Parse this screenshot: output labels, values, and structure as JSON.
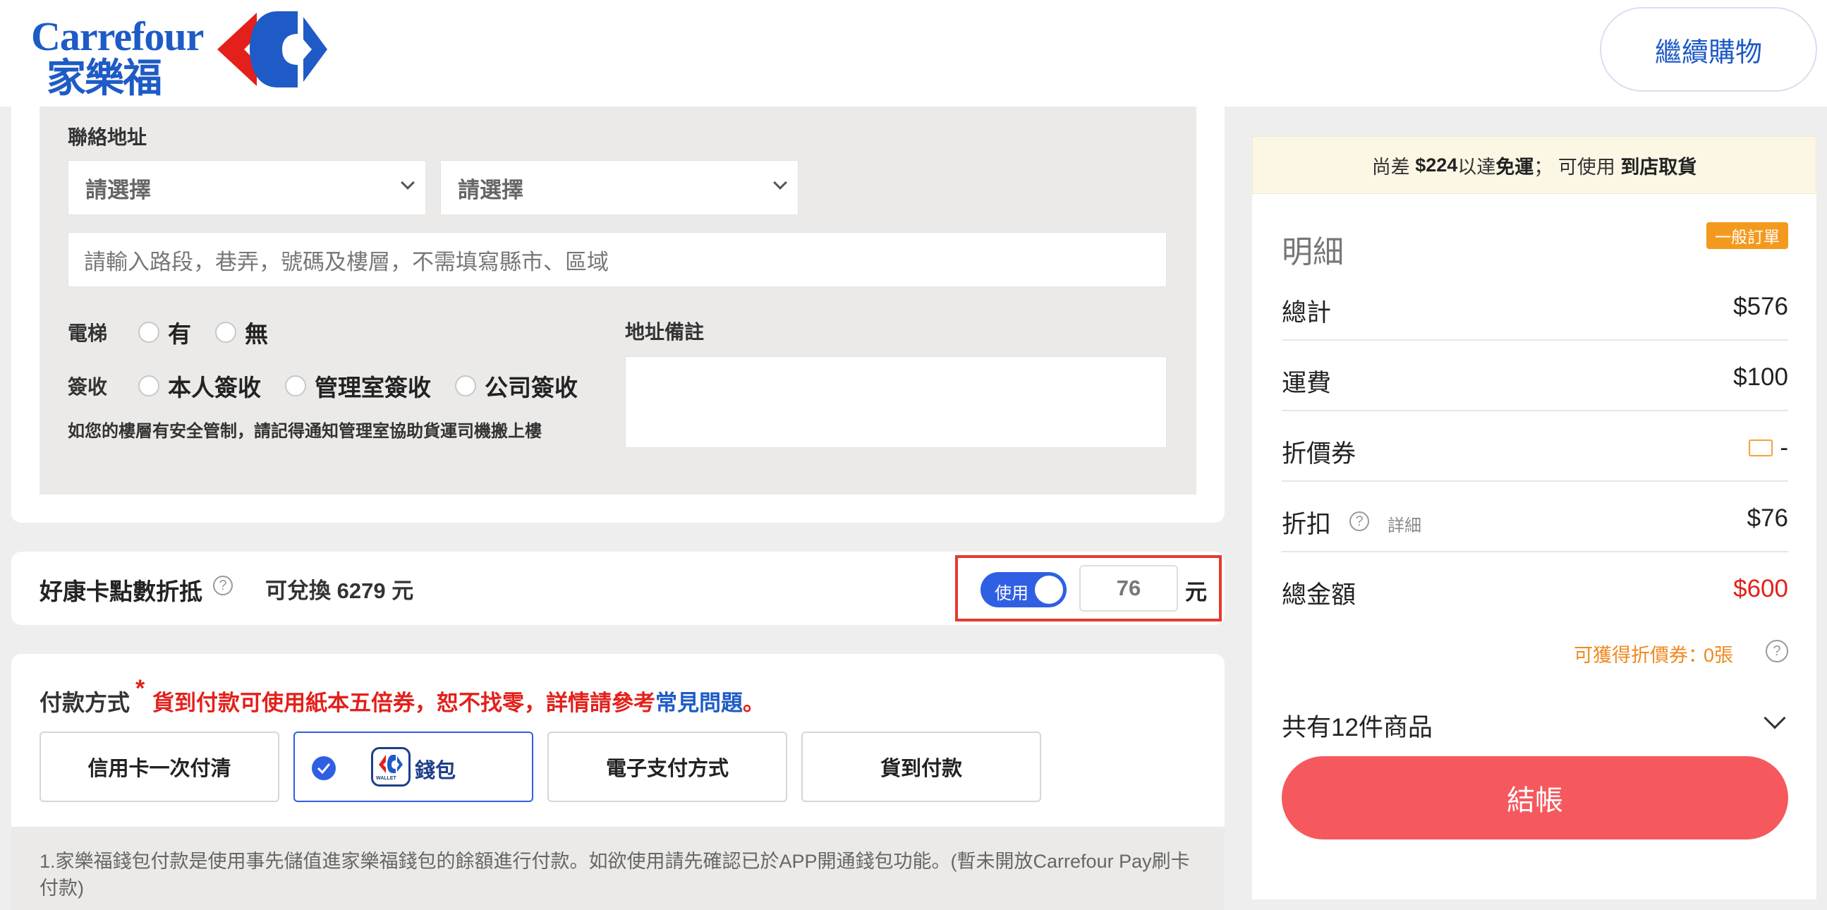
{
  "header": {
    "brand_en": "Carrefour",
    "brand_zh": "家樂福",
    "continue_label": "繼續購物"
  },
  "address": {
    "section_label": "聯絡地址",
    "city_select": "請選擇",
    "district_select": "請選擇",
    "street_placeholder": "請輸入路段，巷弄，號碼及樓層，不需填寫縣市、區域",
    "elevator_label": "電梯",
    "elevator_options": [
      "有",
      "無"
    ],
    "receive_label": "簽收",
    "receive_options": [
      "本人簽收",
      "管理室簽收",
      "公司簽收"
    ],
    "note": "如您的樓層有安全管制，請記得通知管理室協助貨運司機搬上樓",
    "remark_label": "地址備註"
  },
  "points": {
    "title": "好康卡點數折抵",
    "help": "?",
    "available_prefix": "可兌換",
    "available_value": "6279",
    "available_unit": "元",
    "toggle_label": "使用",
    "toggle_on": true,
    "amount": "76",
    "unit": "元"
  },
  "payment": {
    "title": "付款方式",
    "required_mark": "*",
    "warning": "貨到付款可使用紙本五倍券，恕不找零，詳情請參考",
    "faq_link": "常見問題",
    "warning_end": "。",
    "options": [
      "信用卡一次付清",
      "錢包",
      "電子支付方式",
      "貨到付款"
    ],
    "selected_index": 1,
    "wallet_icon_text": "WALLET",
    "info": "1.家樂福錢包付款是使用事先儲值進家樂福錢包的餘額進行付款。如欲使用請先確認已於APP開通錢包功能。(暫未開放Carrefour Pay刷卡付款)"
  },
  "summary": {
    "promo_prefix": "尚差",
    "promo_amount": "$224",
    "promo_mid": "以達",
    "promo_free": "免運",
    "promo_sep": "；  可使用",
    "promo_pickup": "到店取貨",
    "title": "明細",
    "badge": "一般訂單",
    "rows": [
      {
        "label": "總計",
        "value": "$576"
      },
      {
        "label": "運費",
        "value": "$100"
      },
      {
        "label": "折價券",
        "value": "-"
      },
      {
        "label": "折扣",
        "value": "$76"
      },
      {
        "label": "總金額",
        "value": "$600"
      }
    ],
    "discount_detail": "詳細",
    "earn_label": "可獲得折價券：",
    "earn_count": "0張",
    "items_label": "共有12件商品",
    "checkout_label": "結帳"
  },
  "colors": {
    "brand_blue": "#1e5bc6",
    "accent_blue": "#2f5fe3",
    "red": "#e3201b",
    "checkout": "#f5595e",
    "orange": "#f39a1e"
  }
}
